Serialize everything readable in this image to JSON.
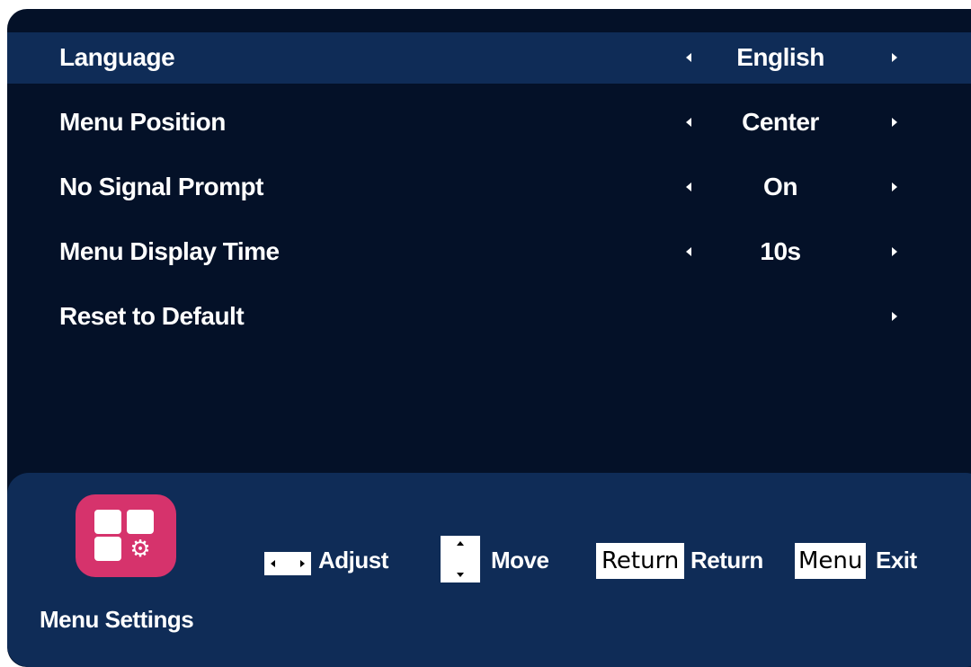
{
  "settings": [
    {
      "label": "Language",
      "value": "English",
      "selected": true,
      "has_left": true
    },
    {
      "label": "Menu Position",
      "value": "Center",
      "selected": false,
      "has_left": true
    },
    {
      "label": "No Signal Prompt",
      "value": "On",
      "selected": false,
      "has_left": true
    },
    {
      "label": "Menu Display Time",
      "value": "10s",
      "selected": false,
      "has_left": true
    },
    {
      "label": "Reset to Default",
      "value": "",
      "selected": false,
      "has_left": false
    }
  ],
  "footer": {
    "title": "Menu Settings",
    "app_icon": "menu-settings-icon",
    "hints": {
      "adjust_label": "Adjust",
      "move_label": "Move",
      "return_key": "Return",
      "return_label": "Return",
      "menu_key": "Menu",
      "exit_label": "Exit"
    }
  },
  "colors": {
    "background": "#041128",
    "selected_row": "#0f2c57",
    "footer_bar": "#0f2c57",
    "app_icon": "#d6336c",
    "text": "#ffffff"
  }
}
